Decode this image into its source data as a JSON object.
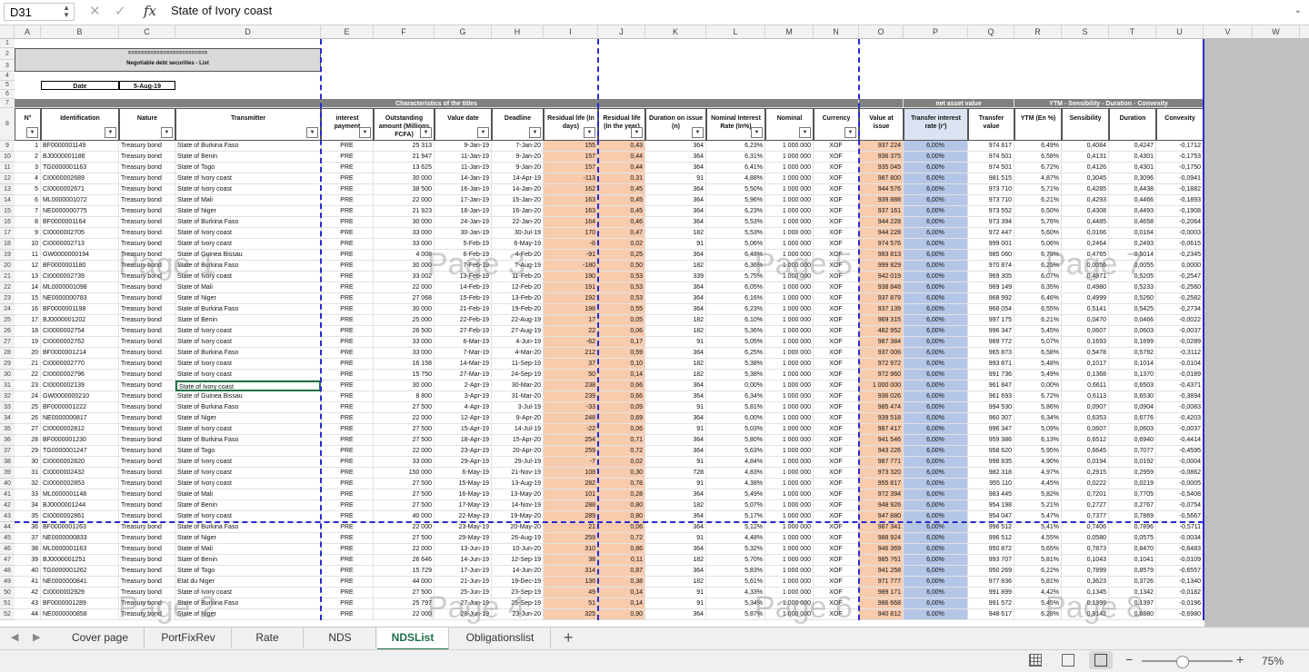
{
  "formula_bar": {
    "cell_ref": "D31",
    "content": "State of Ivory coast"
  },
  "columns": [
    "A",
    "B",
    "C",
    "D",
    "E",
    "F",
    "G",
    "H",
    "I",
    "J",
    "K",
    "L",
    "M",
    "N",
    "O",
    "P",
    "Q",
    "R",
    "S",
    "T",
    "U",
    "V",
    "W"
  ],
  "title": "Negotiable debt securities - List",
  "title_deco": "=========================",
  "date_label": "Date",
  "date_value": "5-Aug-19",
  "group_headers": {
    "characteristics": "Characteristics of the titles",
    "net_asset": "net asset value",
    "ytm": "YTM - Sensibility - Duration - Convexity"
  },
  "headers": [
    "N°",
    "Identification",
    "Nature",
    "Transmitter",
    "interest payment",
    "Outstanding amount (Millions FCFA)",
    "Value date",
    "Deadline",
    "Residual life (In days)",
    "Residual life (In the year)",
    "Duration on issue (n)",
    "Nominal Interest Rate (In%)",
    "Nominal",
    "Currency",
    "Value at issue",
    "Transfer interest rate (r')",
    "Transfer value",
    "YTM (En %)",
    "Sensibility",
    "Duration",
    "Convexity"
  ],
  "watermarks": [
    "Page 1",
    "Page 3",
    "Page 5",
    "Page 7",
    "Page 2",
    "Page 4",
    "Page 6",
    "Page 8"
  ],
  "rows": [
    [
      "1",
      "BF0000001149",
      "Treasury bond",
      "State of Burkina Faso",
      "PRE",
      "25 313",
      "9-Jan-19",
      "7-Jan-20",
      "155",
      "0,43",
      "364",
      "6,23%",
      "1 000 000",
      "XOF",
      "937 224",
      "6,00%",
      "974 817",
      "6,49%",
      "0,4084",
      "0,4247",
      "-0,1712"
    ],
    [
      "2",
      "BJ0000001186",
      "Treasury bond",
      "State of Benin",
      "PRE",
      "21 947",
      "11-Jan-19",
      "9-Jan-20",
      "157",
      "0,44",
      "364",
      "6,31%",
      "1 000 000",
      "XOF",
      "936 375",
      "6,00%",
      "974 501",
      "6,58%",
      "0,4131",
      "0,4301",
      "-0,1753"
    ],
    [
      "3",
      "TG0000001163",
      "Treasury bond",
      "State of Togo",
      "PRE",
      "13 625",
      "11-Jan-19",
      "9-Jan-20",
      "157",
      "0,44",
      "364",
      "6,41%",
      "1 000 000",
      "XOF",
      "935 045",
      "6,00%",
      "974 501",
      "6,72%",
      "0,4126",
      "0,4301",
      "-0,1750"
    ],
    [
      "4",
      "CI0000002689",
      "Treasury bond",
      "State of Ivory coast",
      "PRE",
      "30 000",
      "14-Jan-19",
      "14-Apr-19",
      "-113",
      "0,31",
      "91",
      "4,88%",
      "1 000 000",
      "XOF",
      "987 800",
      "6,00%",
      "981 515",
      "4,87%",
      "0,3045",
      "0,3096",
      "-0,0941"
    ],
    [
      "5",
      "CI0000002671",
      "Treasury bond",
      "State of Ivory coast",
      "PRE",
      "38 500",
      "16-Jan-19",
      "14-Jan-20",
      "162",
      "0,45",
      "364",
      "5,50%",
      "1 000 000",
      "XOF",
      "944 576",
      "6,00%",
      "973 710",
      "5,71%",
      "0,4285",
      "0,4438",
      "-0,1882"
    ],
    [
      "6",
      "ML0000001072",
      "Treasury bond",
      "State of Mali",
      "PRE",
      "22 000",
      "17-Jan-19",
      "15-Jan-20",
      "163",
      "0,45",
      "364",
      "5,96%",
      "1 000 000",
      "XOF",
      "939 888",
      "6,00%",
      "973 710",
      "6,21%",
      "0,4293",
      "0,4466",
      "-0,1893"
    ],
    [
      "7",
      "NE0000000775",
      "Treasury bond",
      "State of Niger",
      "PRE",
      "21 923",
      "18-Jan-19",
      "16-Jan-20",
      "163",
      "0,45",
      "364",
      "6,23%",
      "1 000 000",
      "XOF",
      "937 161",
      "6,00%",
      "973 552",
      "6,50%",
      "0,4308",
      "0,4493",
      "-0,1908"
    ],
    [
      "8",
      "BF0000001164",
      "Treasury bond",
      "State of Burkina Faso",
      "PRE",
      "30 000",
      "24-Jan-19",
      "22-Jan-20",
      "164",
      "0,46",
      "364",
      "5,53%",
      "1 000 000",
      "XOF",
      "944 228",
      "6,00%",
      "973 394",
      "5,76%",
      "0,4485",
      "0,4658",
      "-0,2064"
    ],
    [
      "9",
      "CI0000002705",
      "Treasury bond",
      "State of Ivory coast",
      "PRE",
      "33 000",
      "30-Jan-19",
      "30-Jul-19",
      "170",
      "0,47",
      "182",
      "5,53%",
      "1 000 000",
      "XOF",
      "944 228",
      "6,00%",
      "972 447",
      "5,60%",
      "0,0166",
      "0,0164",
      "-0,0003"
    ],
    [
      "10",
      "CI0000002713",
      "Treasury bond",
      "State of Ivory coast",
      "PRE",
      "33 000",
      "5-Feb-19",
      "6-May-19",
      "-6",
      "0,02",
      "91",
      "5,06%",
      "1 000 000",
      "XOF",
      "974 576",
      "6,00%",
      "999 001",
      "5,06%",
      "0,2464",
      "0,2493",
      "-0,0615"
    ],
    [
      "11",
      "GW0000000194",
      "Treasury bond",
      "State of Guinea Bissau",
      "PRE",
      "4 008",
      "6-Feb-19",
      "4-Feb-20",
      "-91",
      "0,25",
      "364",
      "6,48%",
      "1 000 000",
      "XOF",
      "983 813",
      "6,00%",
      "985 060",
      "6,79%",
      "0,4765",
      "0,5014",
      "-0,2345"
    ],
    [
      "12",
      "BF0000001180",
      "Treasury bond",
      "State of Burkina Faso",
      "PRE",
      "30 000",
      "7-Feb-19",
      "7-Aug-19",
      "-180",
      "0,50",
      "182",
      "6,36%",
      "1 000 000",
      "XOF",
      "999 829",
      "6,00%",
      "970 874",
      "6,25%",
      "0,0056",
      "0,0055",
      "0,0000"
    ],
    [
      "13",
      "CI0000002739",
      "Treasury bond",
      "State of Ivory coast",
      "PRE",
      "33 002",
      "13-Feb-19",
      "11-Feb-20",
      "190",
      "0,53",
      "339",
      "5,75%",
      "1 000 000",
      "XOF",
      "942 019",
      "6,00%",
      "969 305",
      "6,07%",
      "0,4971",
      "0,5205",
      "-0,2547"
    ],
    [
      "14",
      "ML0000001098",
      "Treasury bond",
      "State of Mali",
      "PRE",
      "22 000",
      "14-Feb-19",
      "12-Feb-20",
      "191",
      "0,53",
      "364",
      "6,05%",
      "1 000 000",
      "XOF",
      "938 848",
      "6,00%",
      "969 149",
      "6,35%",
      "0,4980",
      "0,5233",
      "-0,2560"
    ],
    [
      "15",
      "NE0000000783",
      "Treasury bond",
      "State of Niger",
      "PRE",
      "27 068",
      "15-Feb-19",
      "13-Feb-20",
      "192",
      "0,53",
      "364",
      "6,16%",
      "1 000 000",
      "XOF",
      "937 879",
      "6,00%",
      "968 992",
      "6,46%",
      "0,4999",
      "0,5260",
      "-0,2582"
    ],
    [
      "16",
      "BF0000001198",
      "Treasury bond",
      "State of Burkina Faso",
      "PRE",
      "30 000",
      "21-Feb-19",
      "19-Feb-20",
      "198",
      "0,55",
      "364",
      "6,23%",
      "1 000 000",
      "XOF",
      "937 139",
      "6,00%",
      "968 054",
      "6,55%",
      "0,5141",
      "0,5425",
      "-0,2734"
    ],
    [
      "17",
      "BJ0000001202",
      "Treasury bond",
      "State of Benin",
      "PRE",
      "25 000",
      "22-Feb-19",
      "22-Aug-19",
      "17",
      "0,05",
      "182",
      "6,10%",
      "1 000 000",
      "XOF",
      "969 315",
      "6,00%",
      "997 175",
      "6,21%",
      "0,0470",
      "0,0466",
      "-0,0022"
    ],
    [
      "18",
      "CI0000002754",
      "Treasury bond",
      "State of Ivory coast",
      "PRE",
      "26 500",
      "27-Feb-19",
      "27-Aug-19",
      "22",
      "0,06",
      "182",
      "5,36%",
      "1 000 000",
      "XOF",
      "482 952",
      "6,00%",
      "996 347",
      "5,45%",
      "0,0607",
      "0,0603",
      "-0,0037"
    ],
    [
      "19",
      "CI0000002762",
      "Treasury bond",
      "State of Ivory coast",
      "PRE",
      "33 000",
      "6-Mar-19",
      "4-Jun-19",
      "-62",
      "0,17",
      "91",
      "5,05%",
      "1 000 000",
      "XOF",
      "987 384",
      "6,00%",
      "989 772",
      "5,07%",
      "0,1693",
      "0,1699",
      "-0,0289"
    ],
    [
      "20",
      "BF0000001214",
      "Treasury bond",
      "State of Burkina Faso",
      "PRE",
      "33 000",
      "7-Mar-19",
      "4-Mar-20",
      "212",
      "0,59",
      "364",
      "6,25%",
      "1 000 000",
      "XOF",
      "937 006",
      "6,00%",
      "965 873",
      "6,58%",
      "0,5478",
      "0,5792",
      "-0,3112"
    ],
    [
      "21",
      "CI0000002770",
      "Treasury bond",
      "State of Ivory coast",
      "PRE",
      "16 158",
      "14-Mar-19",
      "11-Sep-19",
      "37",
      "0,10",
      "182",
      "5,38%",
      "1 000 000",
      "XOF",
      "972 972",
      "6,00%",
      "993 871",
      "5,48%",
      "0,1017",
      "0,1014",
      "-0,0104"
    ],
    [
      "22",
      "CI0000002796",
      "Treasury bond",
      "State of Ivory coast",
      "PRE",
      "15 750",
      "27-Mar-19",
      "24-Sep-19",
      "50",
      "0,14",
      "182",
      "5,38%",
      "1 000 000",
      "XOF",
      "972 960",
      "6,00%",
      "991 736",
      "5,49%",
      "0,1368",
      "0,1370",
      "-0,0189"
    ],
    [
      "23",
      "CI0000002139",
      "Treasury bond",
      "State of Ivory coast",
      "PRE",
      "30 000",
      "2-Apr-19",
      "30-Mar-20",
      "238",
      "0,66",
      "364",
      "0,00%",
      "1 000 000",
      "XOF",
      "1 000 000",
      "6,00%",
      "961 847",
      "0,00%",
      "0,6611",
      "0,6503",
      "-0,4371"
    ],
    [
      "24",
      "GW0000000210",
      "Treasury bond",
      "State of Guinea Bissau",
      "PRE",
      "8 800",
      "3-Apr-19",
      "31-Mar-20",
      "239",
      "0,66",
      "364",
      "6,34%",
      "1 000 000",
      "XOF",
      "936 026",
      "6,00%",
      "961 693",
      "6,72%",
      "0,6113",
      "0,6530",
      "-0,3894"
    ],
    [
      "25",
      "BF0000001222",
      "Treasury bond",
      "State of Burkina Faso",
      "PRE",
      "27 500",
      "4-Apr-19",
      "3-Jul-19",
      "-33",
      "0,09",
      "91",
      "5,81%",
      "1 000 000",
      "XOF",
      "985 474",
      "6,00%",
      "994 530",
      "5,86%",
      "0,0907",
      "0,0904",
      "-0,0083"
    ],
    [
      "26",
      "NE0000000817",
      "Treasury bond",
      "State of Niger",
      "PRE",
      "22 000",
      "12-Apr-19",
      "9-Apr-20",
      "248",
      "0,69",
      "364",
      "6,00%",
      "1 000 000",
      "XOF",
      "939 518",
      "6,00%",
      "960 307",
      "6,34%",
      "0,6353",
      "0,6776",
      "-0,4203"
    ],
    [
      "27",
      "CI0000002812",
      "Treasury bond",
      "State of Ivory coast",
      "PRE",
      "27 500",
      "15-Apr-19",
      "14-Jul-19",
      "-22",
      "0,06",
      "91",
      "5,03%",
      "1 000 000",
      "XOF",
      "987 417",
      "6,00%",
      "996 347",
      "5,09%",
      "0,0607",
      "0,0603",
      "-0,0037"
    ],
    [
      "28",
      "BF0000001230",
      "Treasury bond",
      "State of Burkina Faso",
      "PRE",
      "27 500",
      "18-Apr-19",
      "15-Apr-20",
      "254",
      "0,71",
      "364",
      "5,80%",
      "1 000 000",
      "XOF",
      "941 546",
      "6,00%",
      "959 386",
      "6,13%",
      "0,6512",
      "0,6940",
      "-0,4414"
    ],
    [
      "29",
      "TG0000001247",
      "Treasury bond",
      "State of Togo",
      "PRE",
      "22 000",
      "23-Apr-19",
      "20-Apr-20",
      "259",
      "0,72",
      "364",
      "5,63%",
      "1 000 000",
      "XOF",
      "943 226",
      "6,00%",
      "958 620",
      "5,95%",
      "0,6645",
      "0,7077",
      "-0,4595"
    ],
    [
      "30",
      "CI0000002820",
      "Treasury bond",
      "State of Ivory coast",
      "PRE",
      "33 000",
      "29-Apr-19",
      "29-Jul-19",
      "-7",
      "0,02",
      "91",
      "4,84%",
      "1 000 000",
      "XOF",
      "987 771",
      "6,00%",
      "998 835",
      "4,90%",
      "0,0194",
      "0,0192",
      "-0,0004"
    ],
    [
      "31",
      "CI0000002432",
      "Treasury bond",
      "State of Ivory coast",
      "PRE",
      "150 000",
      "6-May-19",
      "21-Nov-19",
      "108",
      "0,30",
      "728",
      "4,83%",
      "1 000 000",
      "XOF",
      "973 320",
      "6,00%",
      "982 318",
      "4,97%",
      "0,2915",
      "0,2959",
      "-0,0862"
    ],
    [
      "32",
      "CI0000002853",
      "Treasury bond",
      "State of Ivory coast",
      "PRE",
      "27 500",
      "15-May-19",
      "13-Aug-19",
      "282",
      "0,78",
      "91",
      "4,38%",
      "1 000 000",
      "XOF",
      "955 817",
      "6,00%",
      "955 110",
      "4,45%",
      "0,0222",
      "0,0219",
      "-0,0005"
    ],
    [
      "33",
      "ML0000001148",
      "Treasury bond",
      "State of Mali",
      "PRE",
      "27 500",
      "16-May-19",
      "13-May-20",
      "101",
      "0,28",
      "364",
      "5,49%",
      "1 000 000",
      "XOF",
      "972 394",
      "6,00%",
      "983 445",
      "5,82%",
      "0,7201",
      "0,7705",
      "-0,5408"
    ],
    [
      "34",
      "BJ0000001244",
      "Treasury bond",
      "State of Benin",
      "PRE",
      "27 500",
      "17-May-19",
      "14-Nov-19",
      "288",
      "0,80",
      "182",
      "5,07%",
      "1 000 000",
      "XOF",
      "948 926",
      "6,00%",
      "954 198",
      "5,21%",
      "0,2727",
      "0,2767",
      "-0,0754"
    ],
    [
      "35",
      "CI0000002861",
      "Treasury bond",
      "State of Ivory coast",
      "PRE",
      "40 000",
      "22-May-19",
      "19-May-20",
      "289",
      "0,80",
      "364",
      "5,17%",
      "1 000 000",
      "XOF",
      "947 880",
      "6,00%",
      "954 047",
      "5,47%",
      "0,7377",
      "0,7869",
      "-0,5667"
    ],
    [
      "36",
      "BF0000001263",
      "Treasury bond",
      "State of Burkina Faso",
      "PRE",
      "22 000",
      "23-May-19",
      "20-May-20",
      "21",
      "0,06",
      "364",
      "5,12%",
      "1 000 000",
      "XOF",
      "987 341",
      "6,00%",
      "996 512",
      "5,41%",
      "0,7406",
      "0,7896",
      "-0,5711"
    ],
    [
      "37",
      "NE0000000833",
      "Treasury bond",
      "State of Niger",
      "PRE",
      "27 500",
      "29-May-19",
      "26-Aug-19",
      "259",
      "0,72",
      "91",
      "4,48%",
      "1 000 000",
      "XOF",
      "988 924",
      "6,00%",
      "996 512",
      "4,55%",
      "0,0580",
      "0,0575",
      "-0,0034"
    ],
    [
      "38",
      "ML0000001163",
      "Treasury bond",
      "State of Mali",
      "PRE",
      "22 000",
      "13-Jun-19",
      "10-Jun-20",
      "310",
      "0,86",
      "364",
      "5,32%",
      "1 000 000",
      "XOF",
      "946 369",
      "6,00%",
      "950 872",
      "5,65%",
      "0,7873",
      "0,8470",
      "-0,6483"
    ],
    [
      "39",
      "BJ0000001251",
      "Treasury bond",
      "State of Benin",
      "PRE",
      "26 646",
      "14-Jun-19",
      "12-Sep-19",
      "38",
      "0,11",
      "182",
      "5,70%",
      "1 000 000",
      "XOF",
      "985 761",
      "6,00%",
      "993 707",
      "5,81%",
      "0,1043",
      "0,1041",
      "-0,0109"
    ],
    [
      "40",
      "TG0000001262",
      "Treasury bond",
      "State of Togo",
      "PRE",
      "15 729",
      "17-Jun-19",
      "14-Jun-20",
      "314",
      "0,87",
      "364",
      "5,83%",
      "1 000 000",
      "XOF",
      "941 258",
      "6,00%",
      "950 269",
      "6,22%",
      "0,7899",
      "0,8579",
      "-0,6557"
    ],
    [
      "41",
      "NE0000000841",
      "Treasury bond",
      "Etat du Niger",
      "PRE",
      "44 000",
      "21-Jun-19",
      "19-Dec-19",
      "136",
      "0,38",
      "182",
      "5,61%",
      "1 000 000",
      "XOF",
      "971 777",
      "6,00%",
      "977 836",
      "5,81%",
      "0,3623",
      "0,3726",
      "-0,1340"
    ],
    [
      "42",
      "CI0000002929",
      "Treasury bond",
      "State of Ivory coast",
      "PRE",
      "27 500",
      "25-Jun-19",
      "23-Sep-19",
      "49",
      "0,14",
      "91",
      "4,33%",
      "1 000 000",
      "XOF",
      "989 171",
      "6,00%",
      "991 899",
      "4,42%",
      "0,1345",
      "0,1342",
      "-0,0182"
    ],
    [
      "43",
      "BF0000001289",
      "Treasury bond",
      "State of Burkina Faso",
      "PRE",
      "25 797",
      "27-Jun-19",
      "25-Sep-19",
      "51",
      "0,14",
      "91",
      "5,34%",
      "1 000 000",
      "XOF",
      "986 668",
      "6,00%",
      "991 572",
      "5,45%",
      "0,1399",
      "0,1397",
      "-0,0196"
    ],
    [
      "44",
      "NE0000000858",
      "Treasury bond",
      "State of Niger",
      "PRE",
      "22 000",
      "28-Jun-19",
      "23-Jun-20",
      "325",
      "0,90",
      "364",
      "5,87%",
      "1 000 000",
      "XOF",
      "940 812",
      "6,00%",
      "948 617",
      "6,28%",
      "0,8142",
      "0,8880",
      "-0,6980"
    ]
  ],
  "tabs": [
    "Cover page",
    "PortFixRev",
    "Rate",
    "NDS",
    "NDSList",
    "Obligationslist"
  ],
  "active_tab": "NDSList",
  "zoom": "75%"
}
